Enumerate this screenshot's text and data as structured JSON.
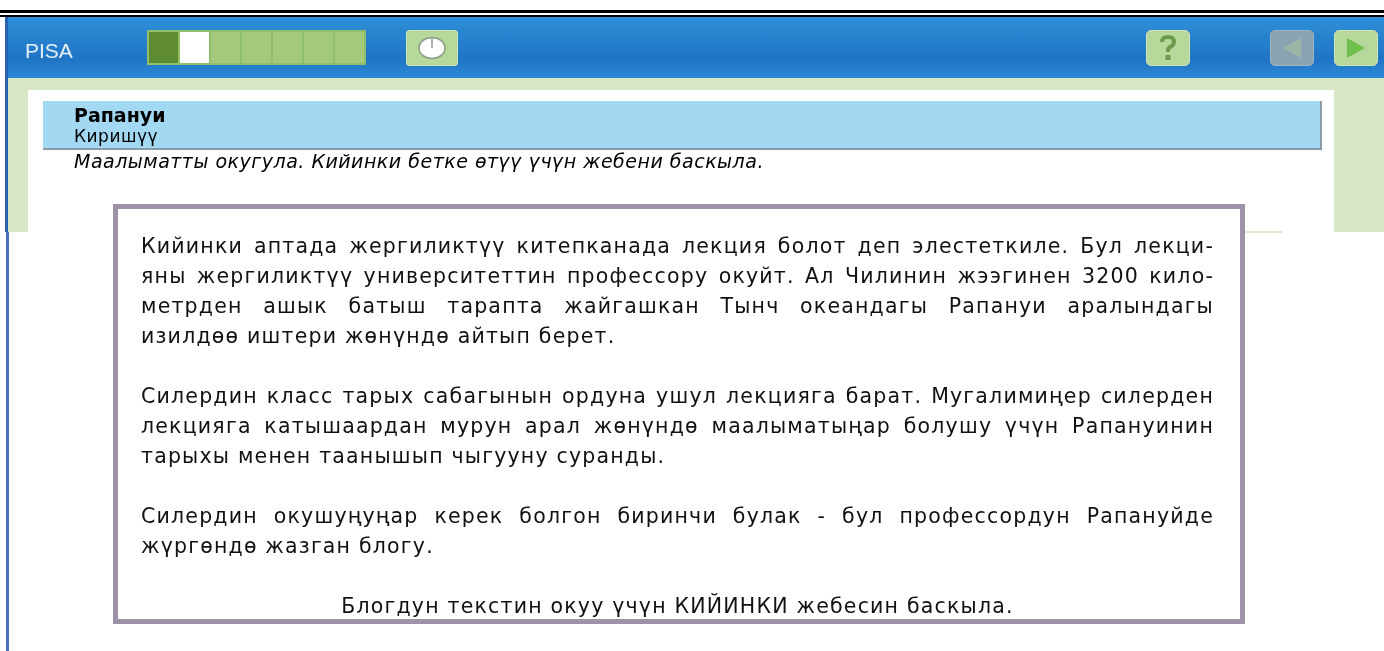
{
  "header": {
    "title": "PISA",
    "progress": [
      {
        "completed": true,
        "selected": false
      },
      {
        "completed": false,
        "selected": true
      },
      {
        "completed": false,
        "selected": false
      },
      {
        "completed": false,
        "selected": false
      },
      {
        "completed": false,
        "selected": false
      },
      {
        "completed": false,
        "selected": false
      },
      {
        "completed": false,
        "selected": false
      }
    ],
    "back_disabled": true,
    "next_disabled": false
  },
  "unit": {
    "title": "Рапануи",
    "subtitle": "Киришүү",
    "instruction": "Маалыматты окугула. Кийинки бетке өтүү үчүн жебени баскыла."
  },
  "dialog": {
    "paragraphs": [
      {
        "kind": "body",
        "lines": [
          "Кийинки аптада жергиликтүү китепканада лекция болот деп элестеткиле. Бул лекци-",
          "яны жергиликтүү университеттин профессору окуйт. Ал Чилинин жээгинен 3200 кило-",
          "метрден ашык батыш тарапта жайгашкан Тынч океандагы Рапануи аралындагы",
          "изилдөө иштери жөнүндө айтып берет."
        ]
      },
      {
        "kind": "body",
        "lines": [
          "Силердин класс тарых сабагынын ордуна ушул лекцияга барат. Мугалимиңер силерден",
          "лекцияга катышаардан мурун арал жөнүндө маалыматыңар болушу үчүн Рапануинин",
          "тарыхы менен таанышып чыгууну суранды."
        ]
      },
      {
        "kind": "body",
        "lines": [
          "Силердин окушуңуңар керек болгон биринчи булак - бул профессордун Рапануйде",
          "жүргөндө жазган блогу."
        ]
      },
      {
        "kind": "call_to_action",
        "lines": [
          "Блогдун текстин окуу үчүн КИЙИНКИ жебесин баскыла."
        ]
      }
    ]
  }
}
